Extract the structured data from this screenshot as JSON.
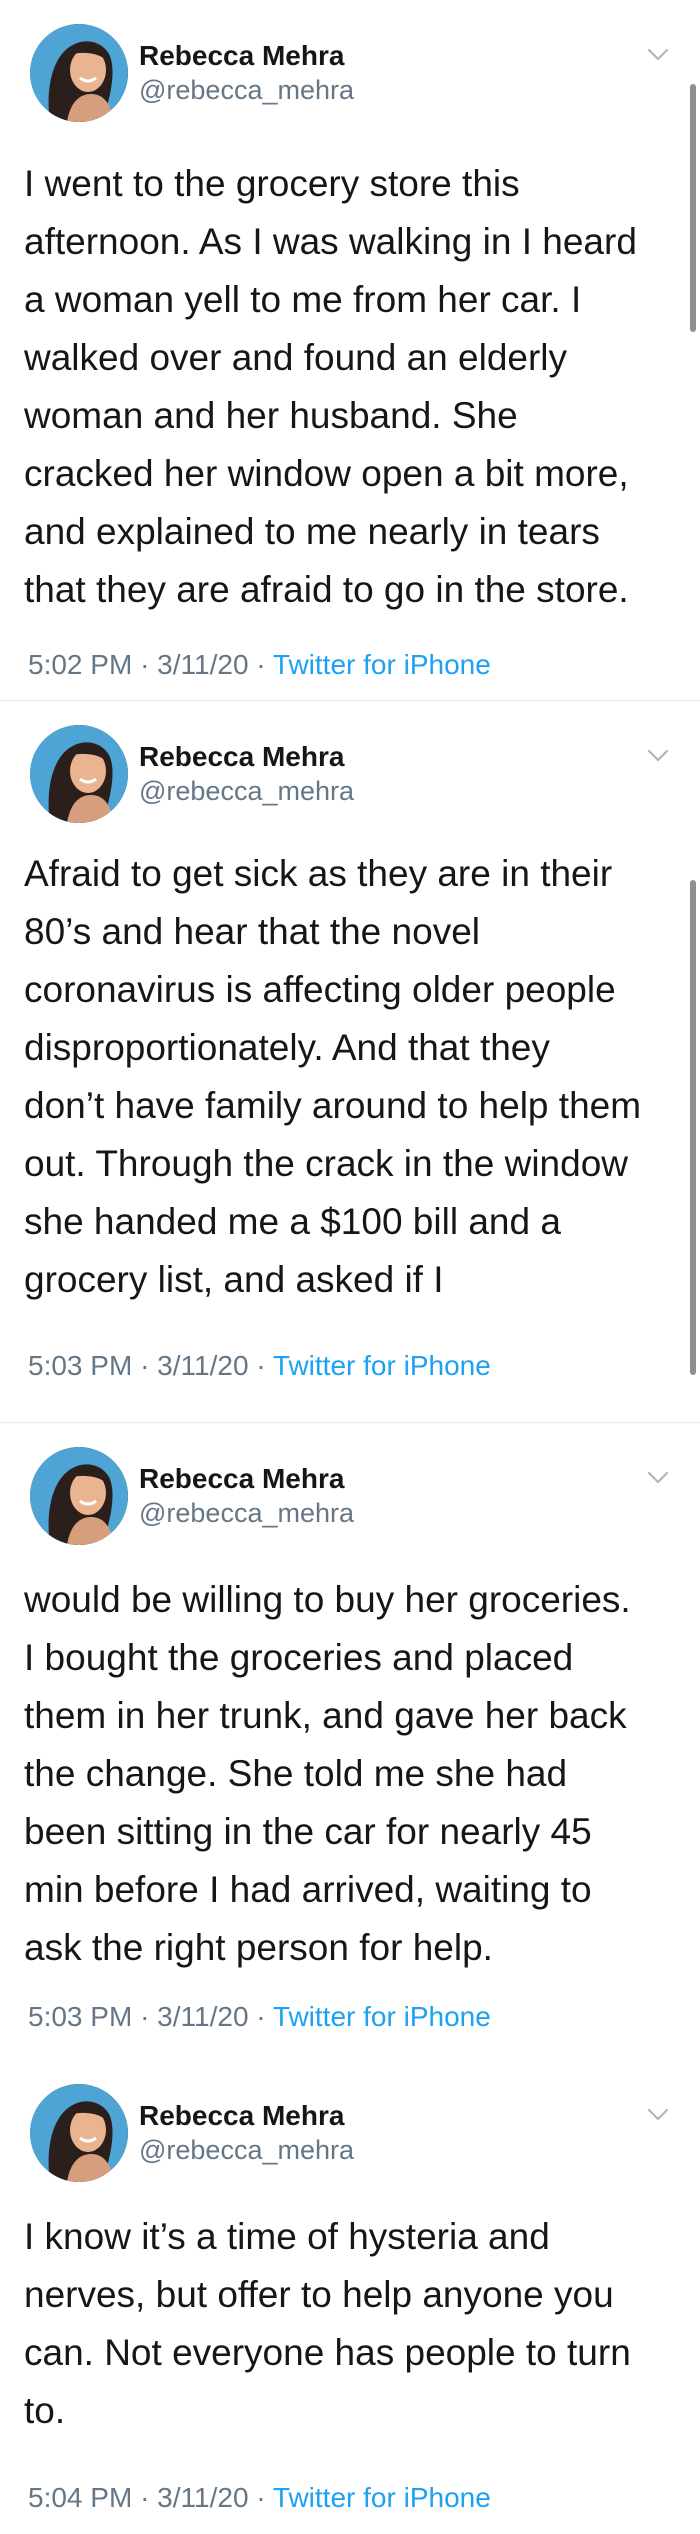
{
  "tweets": [
    {
      "author_name": "Rebecca Mehra",
      "author_handle": "@rebecca_mehra",
      "text": "I went to the grocery store this\nafternoon. As I was walking in I heard\na woman yell to me from her car. I\nwalked over and found an elderly\nwoman and her husband. She\ncracked her window open a bit more,\nand explained to me nearly in tears\nthat they are afraid to go in the store.",
      "time": "5:02 PM",
      "date": "3/11/20",
      "source": "Twitter for iPhone"
    },
    {
      "author_name": "Rebecca Mehra",
      "author_handle": "@rebecca_mehra",
      "text": "Afraid to get sick as they are in their\n80’s and hear that the novel\ncoronavirus is affecting older people\ndisproportionately. And that they\ndon’t have family around to help them\nout. Through the crack in the window\nshe handed me a $100 bill and a\ngrocery list, and asked if I",
      "time": "5:03 PM",
      "date": "3/11/20",
      "source": "Twitter for iPhone"
    },
    {
      "author_name": "Rebecca Mehra",
      "author_handle": "@rebecca_mehra",
      "text": "would be willing to buy her groceries.\nI bought the groceries and placed\nthem in her trunk, and gave her back\nthe change. She told me she had\nbeen sitting in the car for nearly 45\nmin before I had arrived, waiting to\nask the right person for help.",
      "time": "5:03 PM",
      "date": "3/11/20",
      "source": "Twitter for iPhone"
    },
    {
      "author_name": "Rebecca Mehra",
      "author_handle": "@rebecca_mehra",
      "text": "I know it’s a time of hysteria and\nnerves, but offer to help anyone you\ncan. Not everyone has people to turn\nto.",
      "time": "5:04 PM",
      "date": "3/11/20",
      "source": "Twitter for iPhone"
    }
  ],
  "separator": "·",
  "icons": {
    "menu": "chevron-down-icon",
    "avatar": "avatar"
  },
  "colors": {
    "text": "#14171a",
    "secondary": "#657786",
    "link": "#1da1f2"
  }
}
